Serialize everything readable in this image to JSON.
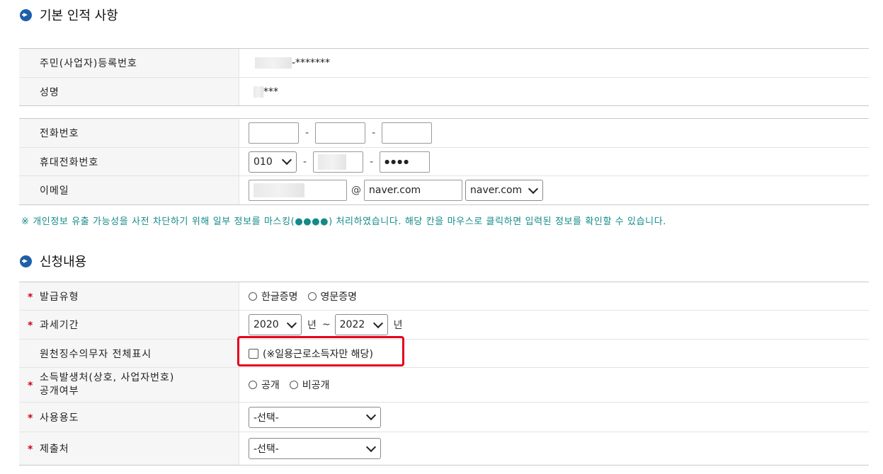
{
  "section1": {
    "title": "기본 인적 사항"
  },
  "basic": {
    "rrn_label": "주민(사업자)등록번호",
    "rrn_value": "-*******",
    "name_label": "성명",
    "name_value": "***"
  },
  "contact": {
    "phone_label": "전화번호",
    "mobile_label": "휴대전화번호",
    "mobile_prefix": "010",
    "mobile_last": "●●●●",
    "email_label": "이메일",
    "email_at": "@",
    "email_domain_value": "naver.com",
    "email_domain_select": "naver.com",
    "dash": "-"
  },
  "notice": "※ 개인정보 유출 가능성을 사전 차단하기 위해 일부 정보를 마스킹(●●●●) 처리하였습니다. 해당 칸을 마우스로 클릭하면 입력된 정보를 확인할 수 있습니다.",
  "section2": {
    "title": "신청내용"
  },
  "application": {
    "issue_type_label": "발급유형",
    "issue_options": [
      "한글증명",
      "영문증명"
    ],
    "tax_period_label": "과세기간",
    "year_from": "2020",
    "year_to": "2022",
    "year_unit": "년",
    "tilde": "~",
    "withholding_label": "원천징수의무자 전체표시",
    "withholding_note": "(※일용근로소득자만 해당)",
    "income_source_label_1": "소득발생처(상호, 사업자번호)",
    "income_source_label_2": "공개여부",
    "disclosure_options": [
      "공개",
      "비공개"
    ],
    "usage_label": "사용용도",
    "usage_value": "-선택-",
    "submit_to_label": "제출처",
    "submit_to_value": "-선택-"
  }
}
